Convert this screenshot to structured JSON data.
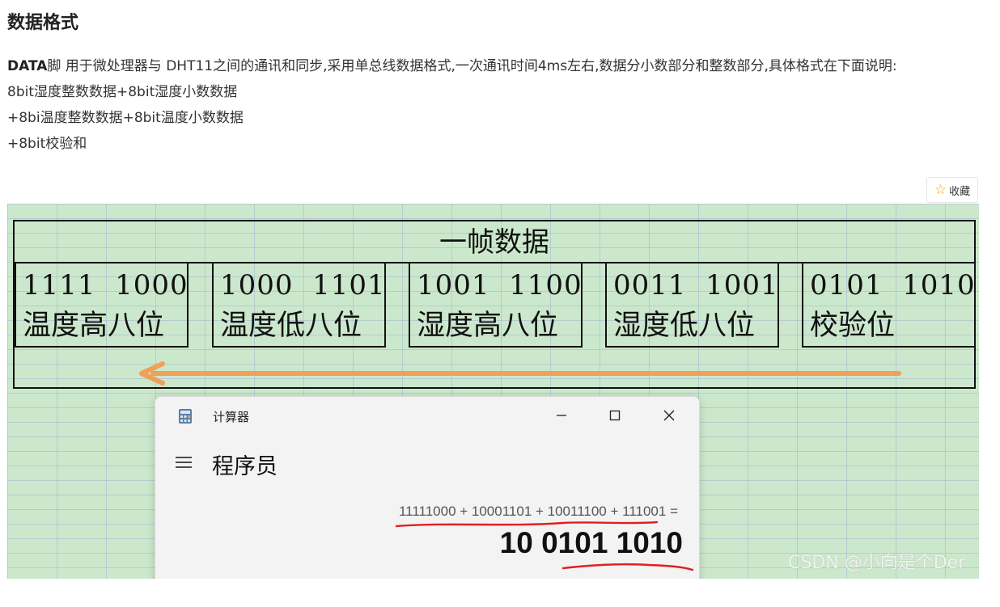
{
  "article": {
    "heading": "数据格式",
    "desc_bold": "DATA",
    "desc_rest": "脚 用于微处理器与 DHT11之间的通讯和同步,采用单总线数据格式,一次通讯时间4ms左右,数据分小数部分和整数部分,具体格式在下面说明:",
    "format_lines": [
      "8bit湿度整数数据+8bit湿度小数数据",
      "+8bi温度整数数据+8bit温度小数数据",
      "+8bit校验和"
    ]
  },
  "collect": {
    "label": "收藏",
    "icon": "star-outline-icon"
  },
  "frame": {
    "title": "一帧数据",
    "cells": [
      {
        "bits": "1111  1000",
        "label": "温度高八位"
      },
      {
        "bits": "1000  1101",
        "label": "温度低八位"
      },
      {
        "bits": "1001  1100",
        "label": "湿度高八位"
      },
      {
        "bits": "0011  1001",
        "label": "湿度低八位"
      },
      {
        "bits": "0101  1010",
        "label": "校验位"
      }
    ],
    "arrow_color": "#f0a057",
    "arrow_direction": "left"
  },
  "calculator": {
    "app_title": "计算器",
    "mode": "程序员",
    "expression": "11111000 + 10001101 + 10011100 + 111001 =",
    "result": "10 0101 1010",
    "annotation_color": "#e02020"
  },
  "watermark": "CSDN @小向是个Der"
}
